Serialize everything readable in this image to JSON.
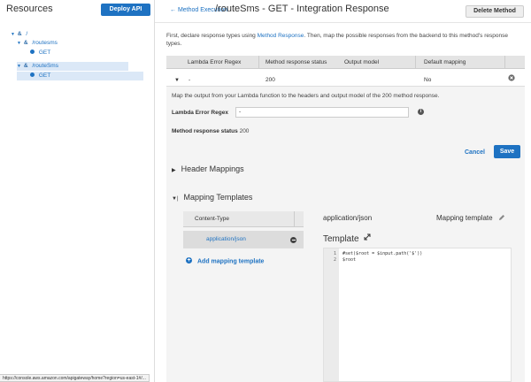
{
  "sidebar": {
    "title": "Resources",
    "deploy_label": "Deploy API",
    "tree": [
      {
        "label": "/",
        "kind": "resource"
      },
      {
        "label": "/routesms",
        "kind": "resource"
      },
      {
        "label": "GET",
        "kind": "method"
      },
      {
        "label": "/routeSms",
        "kind": "resource"
      },
      {
        "label": "GET",
        "kind": "method"
      }
    ]
  },
  "header": {
    "back_label": "Method Execution",
    "title": "/routeSms - GET - Integration Response",
    "delete_label": "Delete Method"
  },
  "intro": {
    "text_before": "First, declare response types using ",
    "link": "Method Response",
    "text_after": ". Then, map the possible responses from the backend to this method's response types."
  },
  "table": {
    "headers": [
      "Lambda Error Regex",
      "Method response status",
      "Output model",
      "Default mapping"
    ],
    "row": {
      "regex": "-",
      "status": "200",
      "model": "",
      "default": "No"
    }
  },
  "detail": {
    "description": "Map the output from your Lambda function to the headers and output model of the 200 method response.",
    "regex_label": "Lambda Error Regex",
    "regex_value": "-",
    "status_label": "Method response status",
    "status_value": "200",
    "cancel_label": "Cancel",
    "save_label": "Save"
  },
  "sections": {
    "header_mappings": "Header Mappings",
    "mapping_templates": "Mapping Templates"
  },
  "mapping": {
    "column_header": "Content-Type",
    "content_type": "application/json",
    "add_label": "Add mapping template",
    "selected_type": "application/json",
    "mapping_template_label": "Mapping template",
    "template_label": "Template",
    "code_lines": [
      {
        "n": "1",
        "text": "#set($root = $input.path('$'))"
      },
      {
        "n": "2",
        "text": "$root"
      }
    ]
  },
  "status_bar": {
    "url": "https://console.aws.amazon.com/apigateway/home?region=us-east-1#/..."
  },
  "colors": {
    "accent": "#1e72c2",
    "selected_row": "#dbe8f7"
  }
}
